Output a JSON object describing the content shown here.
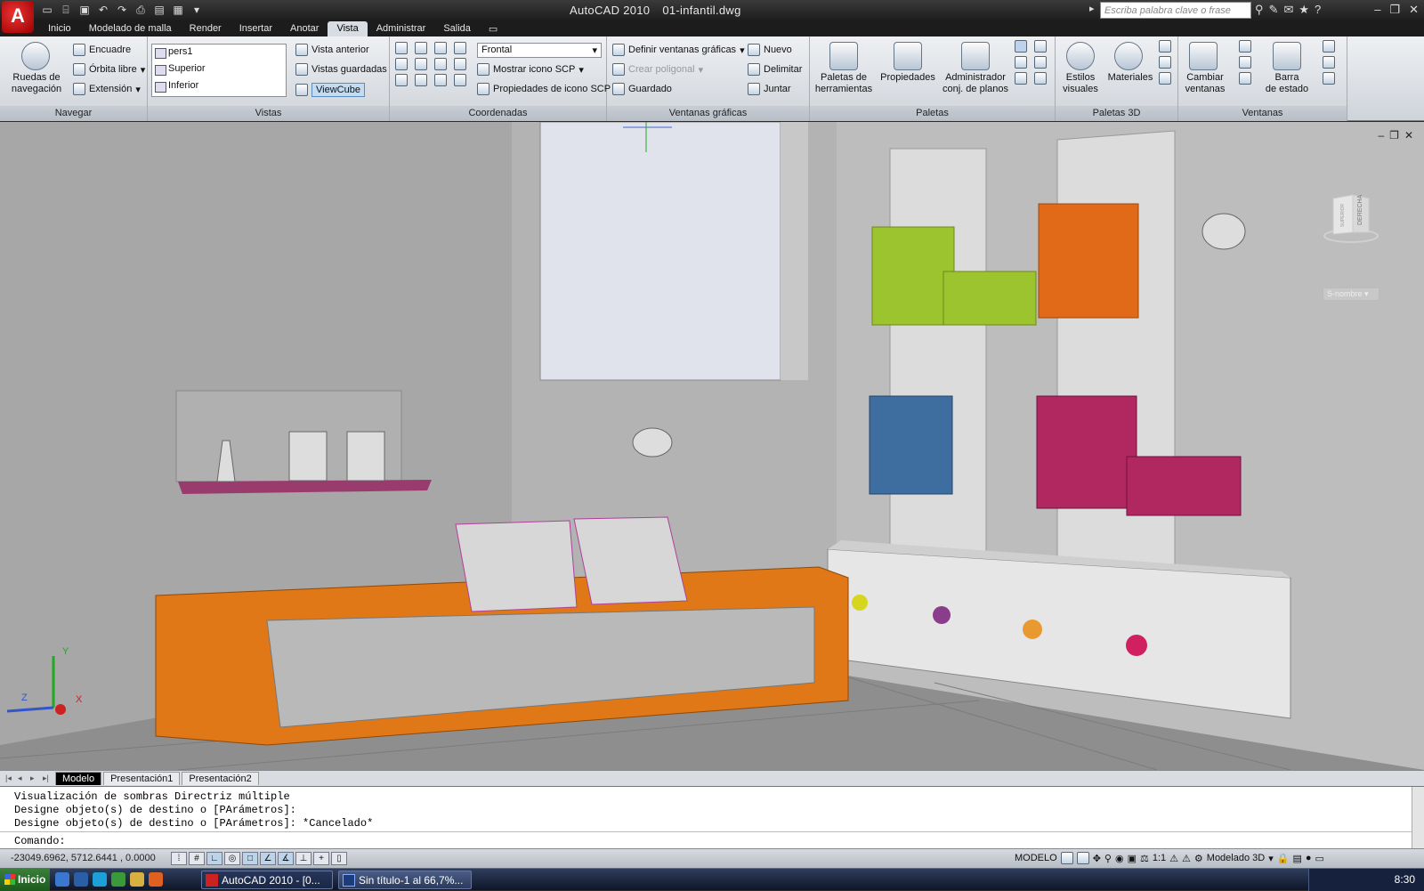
{
  "window": {
    "title": "AutoCAD 2010",
    "filename": "01-infantil.dwg",
    "app_button": "A",
    "search_placeholder": "Escriba palabra clave o frase"
  },
  "tabs": [
    "Inicio",
    "Modelado de malla",
    "Render",
    "Insertar",
    "Anotar",
    "Vista",
    "Administrar",
    "Salida"
  ],
  "active_tab": "Vista",
  "ribbon": {
    "navegar": {
      "title": "Navegar",
      "wheels": "Ruedas de\nnavegación",
      "encuadre": "Encuadre",
      "orbita": "Órbita libre",
      "extension": "Extensión"
    },
    "vistas": {
      "title": "Vistas",
      "list": [
        "pers1",
        "Superior",
        "Inferior"
      ],
      "vista_anterior": "Vista anterior",
      "vistas_guardadas": "Vistas guardadas",
      "viewcube": "ViewCube"
    },
    "coordenadas": {
      "title": "Coordenadas",
      "frontal": "Frontal",
      "mostrar_icono": "Mostrar icono SCP",
      "propiedades_icono": "Propiedades de icono SCP"
    },
    "ventanas_graficas": {
      "title": "Ventanas gráficas",
      "definir": "Definir ventanas gráficas",
      "crear_poligonal": "Crear poligonal",
      "guardado": "Guardado",
      "nuevo": "Nuevo",
      "delimitar": "Delimitar",
      "juntar": "Juntar"
    },
    "paletas": {
      "title": "Paletas",
      "herramientas": "Paletas de\nherramientas",
      "propiedades": "Propiedades",
      "administrador": "Administrador\nconj. de planos"
    },
    "paletas3d": {
      "title": "Paletas 3D",
      "estilos": "Estilos\nvisuales",
      "materiales": "Materiales"
    },
    "ventanas": {
      "title": "Ventanas",
      "cambiar": "Cambiar\nventanas",
      "barra": "Barra\nde estado"
    }
  },
  "viewport": {
    "viewcube_face": "DERECHA",
    "viewcube_face2": "SUPERIOR",
    "snombre": "S-nombre",
    "ucs_x": "X",
    "ucs_y": "Y",
    "ucs_z": "Z"
  },
  "layout_tabs": [
    "Modelo",
    "Presentación1",
    "Presentación2"
  ],
  "command": {
    "history": [
      "Visualización de sombras Directriz múltiple",
      "Designe objeto(s) de destino o [PArámetros]:",
      "Designe objeto(s) de destino o [PArámetros]: *Cancelado*"
    ],
    "prompt": "Comando:"
  },
  "status": {
    "coords": "-23049.6962, 5712.6441 , 0.0000",
    "model": "MODELO",
    "scale": "1:1",
    "workspace": "Modelado 3D"
  },
  "taskbar": {
    "start": "Inicio",
    "tasks": [
      "AutoCAD 2010 - [0...",
      "Sin título-1 al 66,7%..."
    ],
    "clock": "8:30"
  },
  "colors": {
    "viewport_bg": "#a9a9a9",
    "sofa": "#e07818",
    "lime": "#9cc42e",
    "orange": "#e06a18",
    "blue": "#3e6ea0",
    "magenta": "#b0285f"
  }
}
